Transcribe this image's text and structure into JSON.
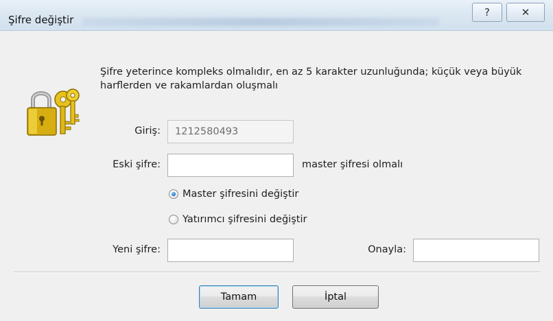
{
  "window": {
    "title": "Şifre değiştir",
    "help_glyph": "?",
    "close_glyph": "✕"
  },
  "info": {
    "icon": "lock-keys-icon",
    "text": "Şifre yeterince kompleks olmalıdır, en az 5 karakter uzunluğunda; küçük veya büyük harflerden ve rakamlardan oluşmalı"
  },
  "form": {
    "login_label": "Giriş:",
    "login_value": "1212580493",
    "old_password_label": "Eski şifre:",
    "old_password_value": "",
    "old_password_hint": "master şifresi olmalı",
    "radio_master_label": "Master şifresini değiştir",
    "radio_investor_label": "Yatırımcı şifresini değiştir",
    "selected_radio": "master",
    "new_password_label": "Yeni şifre:",
    "new_password_value": "",
    "confirm_label": "Onayla:",
    "confirm_value": ""
  },
  "buttons": {
    "ok_label": "Tamam",
    "cancel_label": "İptal"
  },
  "colors": {
    "titlebar": "#dbe7f2",
    "window_bg": "#f0f0f0",
    "lock_gold": "#e8c21a",
    "radio_accent": "#2a7fd0"
  }
}
